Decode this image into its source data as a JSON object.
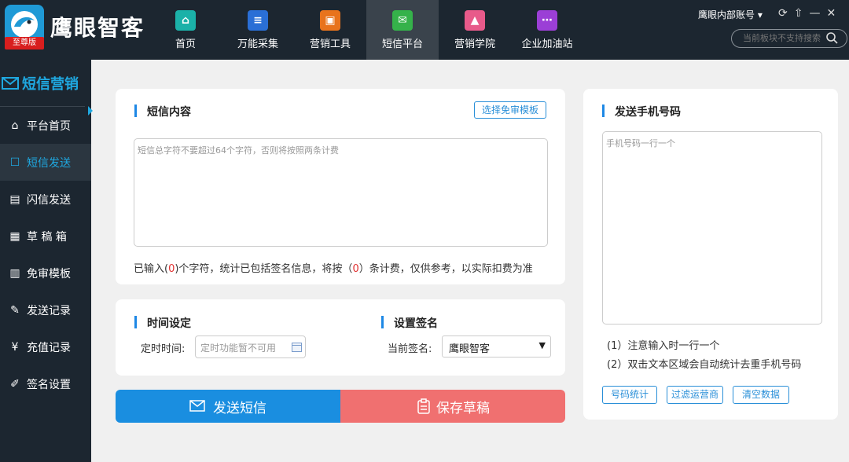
{
  "app": {
    "title": "鹰眼智客",
    "badge": "至尊版"
  },
  "nav": [
    {
      "label": "首页",
      "icon": "home-icon",
      "color": "#1bb1a8"
    },
    {
      "label": "万能采集",
      "icon": "document-icon",
      "color": "#2a6fd6"
    },
    {
      "label": "营销工具",
      "icon": "briefcase-icon",
      "color": "#e8731c"
    },
    {
      "label": "短信平台",
      "icon": "sms-icon",
      "color": "#35b24a",
      "active": true
    },
    {
      "label": "营销学院",
      "icon": "graduation-cap-icon",
      "color": "#e85a8a"
    },
    {
      "label": "企业加油站",
      "icon": "share-icon",
      "color": "#9b3fd6"
    }
  ],
  "account": {
    "name": "鹰眼内部账号"
  },
  "search": {
    "placeholder": "当前板块不支持搜索"
  },
  "sidebar": {
    "header": "短信营销",
    "items": [
      {
        "label": "平台首页",
        "icon": "home-outline-icon"
      },
      {
        "label": "短信发送",
        "icon": "chat-icon",
        "active": true
      },
      {
        "label": "闪信发送",
        "icon": "flash-message-icon"
      },
      {
        "label": "草 稿 箱",
        "icon": "draft-icon"
      },
      {
        "label": "免审模板",
        "icon": "template-icon"
      },
      {
        "label": "发送记录",
        "icon": "record-icon"
      },
      {
        "label": "充值记录",
        "icon": "recharge-icon"
      },
      {
        "label": "签名设置",
        "icon": "signature-icon"
      }
    ]
  },
  "sms": {
    "title": "短信内容",
    "template_button": "选择免审模板",
    "placeholder": "短信总字符不要超过64个字符，否则将按照两条计费",
    "count_prefix": "已输入(",
    "count_value": "0",
    "count_mid": ")个字符，统计已包括签名信息，将按（",
    "billing_value": "0",
    "count_suffix": "）条计费，仅供参考，以实际扣费为准"
  },
  "time": {
    "title": "时间设定",
    "label": "定时时间:",
    "placeholder": "定时功能暂不可用"
  },
  "signature": {
    "title": "设置签名",
    "label": "当前签名:",
    "value": "鹰眼智客"
  },
  "actions": {
    "send": "发送短信",
    "save": "保存草稿"
  },
  "phone": {
    "title": "发送手机号码",
    "placeholder": "手机号码一行一个",
    "tip1": "(1）注意输入时一行一个",
    "tip2": "(2）双击文本区域会自动统计去重手机号码",
    "buttons": [
      "号码统计",
      "过滤运营商",
      "清空数据"
    ]
  }
}
